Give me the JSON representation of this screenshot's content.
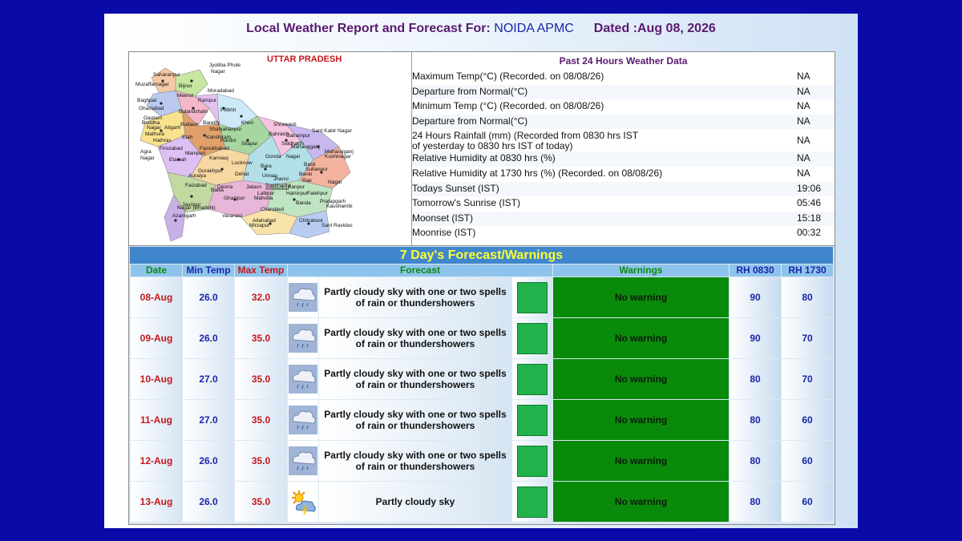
{
  "header": {
    "title_prefix": "Local Weather Report and Forecast For:",
    "location": "NOIDA APMC",
    "dated": "Dated :Aug 08, 2026"
  },
  "map": {
    "state_label": "UTTAR PRADESH",
    "districts": [
      "Saharanpur",
      "Jyotiba Phule",
      "Nagar",
      "Muzaffarnagar",
      "Bijnor",
      "Meerut",
      "Moradabad",
      "Baghpat",
      "Rampur",
      "Ghaziabad",
      "Bulandshahr",
      "Pilibhit",
      "Gautam",
      "Buddha",
      "Nagar",
      "Budaun",
      "Bareilly",
      "Aligarh",
      "Shahjahanpur",
      "Kheri",
      "Shrawasti",
      "Mathura",
      "Hathras",
      "Etah",
      "Kanshiram",
      "Hardoi",
      "Sitapur",
      "Bahraich",
      "Balrampur",
      "Sant Kabir Nagar",
      "Firozabad",
      "Farrukhabad",
      "Siddharth",
      "Maharajganj",
      "Maharajganj",
      "Agra",
      "Mainpuri",
      "Gonda",
      "Nagar",
      "Kushinagar",
      "Nagar",
      "Etawah",
      "Kannauj",
      "Lucknow",
      "Bara",
      "Basti",
      "Gorakhpur",
      "Auraiya",
      "Dehat",
      "Unnao",
      "Banki",
      "Faizabad",
      "Deoria",
      "Jalaun",
      "Kanpur",
      "Rae",
      "Nagar",
      "Azamgarh",
      "Ballia",
      "Lalitpur",
      "Hamirpur",
      "Fatehpur",
      "Pratapgarh",
      "Jaunpur",
      "Ghazipur",
      "Mahoba",
      "Banda",
      "Kaushambi",
      "Varanasi",
      "Chandauli",
      "Chitrakoot",
      "Allahabad",
      "Mirzapur",
      "Sant Ravidas",
      "Nagar (Bhadohi)",
      "Sonbhadra",
      "Jhansi",
      "Sultanpur",
      "Ambedkar",
      "Mau",
      "Gonda"
    ]
  },
  "past24": {
    "heading": "Past 24 Hours Weather Data",
    "rows": [
      {
        "label": "Maximum Temp(°C) (Recorded. on 08/08/26)",
        "value": "NA"
      },
      {
        "label": "Departure from Normal(°C)",
        "value": "NA"
      },
      {
        "label": "Minimum Temp (°C) (Recorded. on 08/08/26)",
        "value": "NA"
      },
      {
        "label": "Departure from Normal(°C)",
        "value": "NA"
      },
      {
        "label": "24 Hours Rainfall (mm) (Recorded from 0830 hrs IST",
        "label2": "of yesterday to 0830 hrs IST of today)",
        "value": "NA"
      },
      {
        "label": "Relative Humidity at 0830 hrs (%)",
        "value": "NA"
      },
      {
        "label": "Relative Humidity at 1730 hrs (%) (Recorded. on 08/08/26)",
        "value": "NA"
      },
      {
        "label": "Todays Sunset (IST)",
        "value": "19:06"
      },
      {
        "label": "Tomorrow's Sunrise (IST)",
        "value": "05:46"
      },
      {
        "label": "Moonset (IST)",
        "value": "15:18"
      },
      {
        "label": "Moonrise (IST)",
        "value": "00:32"
      }
    ]
  },
  "forecast": {
    "title": "7 Day's Forecast/Warnings",
    "columns": {
      "date": "Date",
      "min": "Min Temp",
      "max": "Max Temp",
      "forecast": "Forecast",
      "warnings": "Warnings",
      "rh1": "RH 0830",
      "rh2": "RH 1730"
    },
    "colors": {
      "date": "#0a8a0a",
      "min": "#1a26a8",
      "max": "#c4171b",
      "forecast": "#0a8a0a",
      "warnings": "#0a8a0a",
      "rh": "#1a26a8",
      "warn_bg": "#0a8a0a",
      "warn_square": "#22b24c"
    },
    "rows": [
      {
        "date": "08-Aug",
        "min": "26.0",
        "max": "32.0",
        "icon": "rain-cloud-icon",
        "text1": "Partly cloudy sky with one or two spells",
        "text2": "of rain or thundershowers",
        "warning": "No warning",
        "rh1": "90",
        "rh2": "80"
      },
      {
        "date": "09-Aug",
        "min": "26.0",
        "max": "35.0",
        "icon": "rain-cloud-icon",
        "text1": "Partly cloudy sky with one or two spells",
        "text2": "of rain or thundershowers",
        "warning": "No warning",
        "rh1": "90",
        "rh2": "70"
      },
      {
        "date": "10-Aug",
        "min": "27.0",
        "max": "35.0",
        "icon": "rain-cloud-icon",
        "text1": "Partly cloudy sky with one or two spells",
        "text2": "of rain or thundershowers",
        "warning": "No warning",
        "rh1": "80",
        "rh2": "70"
      },
      {
        "date": "11-Aug",
        "min": "27.0",
        "max": "35.0",
        "icon": "rain-cloud-icon",
        "text1": "Partly cloudy sky with one or two spells",
        "text2": "of rain or thundershowers",
        "warning": "No warning",
        "rh1": "80",
        "rh2": "60"
      },
      {
        "date": "12-Aug",
        "min": "26.0",
        "max": "35.0",
        "icon": "rain-cloud-icon",
        "text1": "Partly cloudy sky with one or two spells",
        "text2": "of rain or thundershowers",
        "warning": "No warning",
        "rh1": "80",
        "rh2": "60"
      },
      {
        "date": "13-Aug",
        "min": "26.0",
        "max": "35.0",
        "icon": "sun-cloud-icon",
        "text1": "Partly cloudy sky",
        "text2": "",
        "warning": "No warning",
        "rh1": "80",
        "rh2": "60"
      }
    ]
  }
}
